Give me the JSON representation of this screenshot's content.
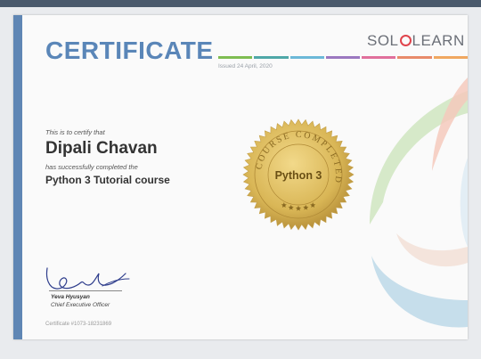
{
  "certificate": {
    "title": "CERTIFICATE",
    "issued": "Issued 24 April, 2020",
    "certify_text": "This is to certify that",
    "recipient_name": "Dipali Chavan",
    "completed_text": "has successfully completed the",
    "course_name": "Python 3 Tutorial course",
    "certificate_number": "Certificate #1073-18231869"
  },
  "brand": {
    "prefix": "SOL",
    "suffix": "LEARN"
  },
  "seal": {
    "ring_text": "COURSE COMPLETED",
    "center_text": "Python 3",
    "star_count": 5
  },
  "signer": {
    "name": "Yeva Hyusyan",
    "title": "Chief Executive Officer"
  },
  "colors": {
    "title": "#5a86b8",
    "left_bar": "#5f86b4",
    "seal_gold": "#d9b656",
    "stripe_colors": [
      "#7ebd52",
      "#4fa8a8",
      "#6cb8d8",
      "#9b78c0",
      "#e0709c",
      "#e88b6a",
      "#f0a860"
    ]
  }
}
